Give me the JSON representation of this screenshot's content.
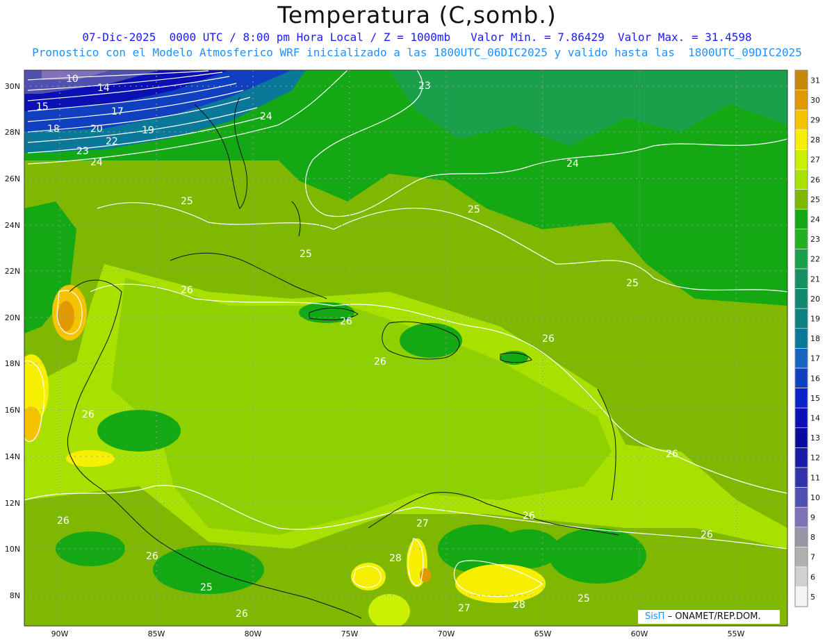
{
  "header": {
    "title": "Temperatura (C,somb.)",
    "line2": "07-Dic-2025  0000 UTC / 8:00 pm Hora Local / Z = 1000mb   Valor Min. = 7.86429  Valor Max. = 31.4598",
    "line3": "Pronostico con el Modelo Atmosferico WRF inicializado a las 1800UTC_06DIC2025 y valido hasta las  1800UTC_09DIC2025"
  },
  "map": {
    "lat_labels": [
      "30N",
      "28N",
      "26N",
      "24N",
      "22N",
      "20N",
      "18N",
      "16N",
      "14N",
      "12N",
      "10N",
      "8N"
    ],
    "lon_labels": [
      "90W",
      "85W",
      "80W",
      "75W",
      "70W",
      "65W",
      "60W",
      "55W"
    ],
    "contour_labels": [
      "10",
      "14",
      "15",
      "17",
      "18",
      "20",
      "19",
      "22",
      "23",
      "24",
      "25",
      "26",
      "27",
      "28",
      "23",
      "24",
      "24",
      "25",
      "25",
      "25",
      "26",
      "26",
      "26",
      "26",
      "26",
      "26",
      "26",
      "26",
      "25",
      "26",
      "27",
      "28",
      "25",
      "26"
    ]
  },
  "colorbar": {
    "values": [
      "31",
      "30",
      "29",
      "28",
      "27",
      "26",
      "25",
      "24",
      "23",
      "22",
      "21",
      "20",
      "19",
      "18",
      "17",
      "16",
      "15",
      "14",
      "13",
      "12",
      "11",
      "10",
      "9",
      "8",
      "7",
      "6",
      "5"
    ],
    "colors": [
      "#c8860a",
      "#e09a00",
      "#f5c400",
      "#f6f000",
      "#c8f000",
      "#a8e000",
      "#7fb800",
      "#14a814",
      "#22b022",
      "#1aa04a",
      "#169060",
      "#128870",
      "#0e8080",
      "#0a7898",
      "#1464c0",
      "#1040c0",
      "#0a20c8",
      "#0a10b4",
      "#0a0aa0",
      "#1a1aa8",
      "#3232a8",
      "#5050b0",
      "#8070b8",
      "#9696a8",
      "#b0b0b0",
      "#d0d0d0",
      "#f4f4f4"
    ]
  },
  "credit": {
    "brand": "SisΠ",
    "text": "– ONAMET/REP.DOM."
  }
}
